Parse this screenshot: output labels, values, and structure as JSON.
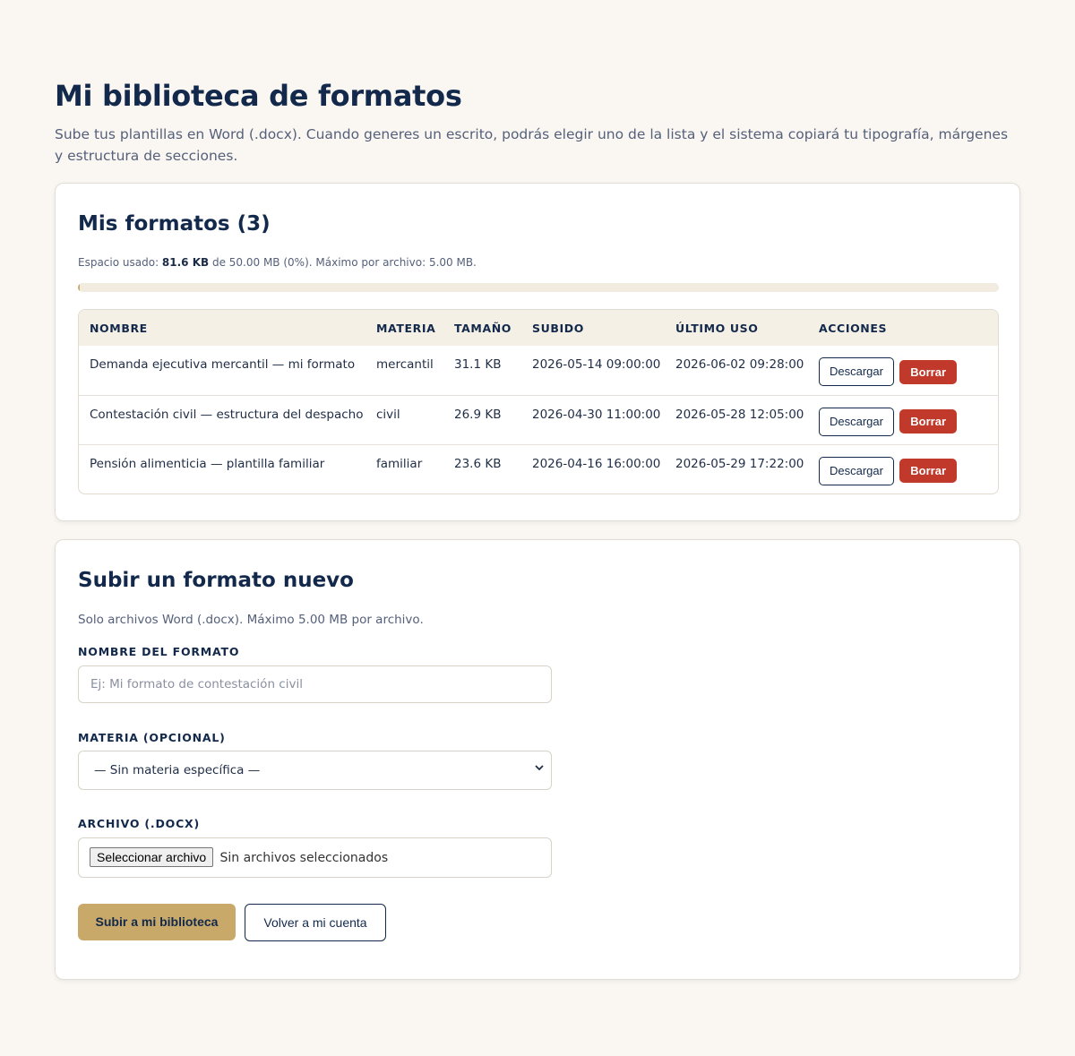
{
  "header": {
    "title": "Mi biblioteca de formatos",
    "intro": "Sube tus plantillas en Word (.docx). Cuando generes un escrito, podrás elegir uno de la lista y el sistema copiará tu tipografía, márgenes y estructura de secciones."
  },
  "library": {
    "title": "Mis formatos (3)",
    "usage_prefix": "Espacio usado: ",
    "usage_used": "81.6 KB",
    "usage_suffix": " de 50.00 MB (0%). Máximo por archivo: 5.00 MB.",
    "usage_fraction": 0.0016,
    "columns": [
      "Nombre",
      "Materia",
      "Tamaño",
      "Subido",
      "Último uso",
      "Acciones"
    ],
    "rows": [
      {
        "name": "Demanda ejecutiva mercantil — mi formato",
        "subject": "mercantil",
        "size": "31.1 KB",
        "uploaded": "2026-05-14 09:00:00",
        "last_used": "2026-06-02 09:28:00"
      },
      {
        "name": "Contestación civil — estructura del despacho",
        "subject": "civil",
        "size": "26.9 KB",
        "uploaded": "2026-04-30 11:00:00",
        "last_used": "2026-05-28 12:05:00"
      },
      {
        "name": "Pensión alimenticia — plantilla familiar",
        "subject": "familiar",
        "size": "23.6 KB",
        "uploaded": "2026-04-16 16:00:00",
        "last_used": "2026-05-29 17:22:00"
      }
    ],
    "download_label": "Descargar",
    "delete_label": "Borrar"
  },
  "upload": {
    "title": "Subir un formato nuevo",
    "hint": "Solo archivos Word (.docx). Máximo 5.00 MB por archivo.",
    "name_label": "Nombre del formato",
    "name_placeholder": "Ej: Mi formato de contestación civil",
    "subject_label": "Materia (opcional)",
    "subject_value": "— Sin materia específica —",
    "file_label": "Archivo (.docx)",
    "file_button": "Seleccionar archivo",
    "file_status": "Sin archivos seleccionados",
    "submit_label": "Subir a mi biblioteca",
    "back_label": "Volver a mi cuenta"
  },
  "colors": {
    "navy": "#13294b",
    "gold": "#c8a96a",
    "danger": "#c0392b",
    "background": "#faf7f2"
  }
}
